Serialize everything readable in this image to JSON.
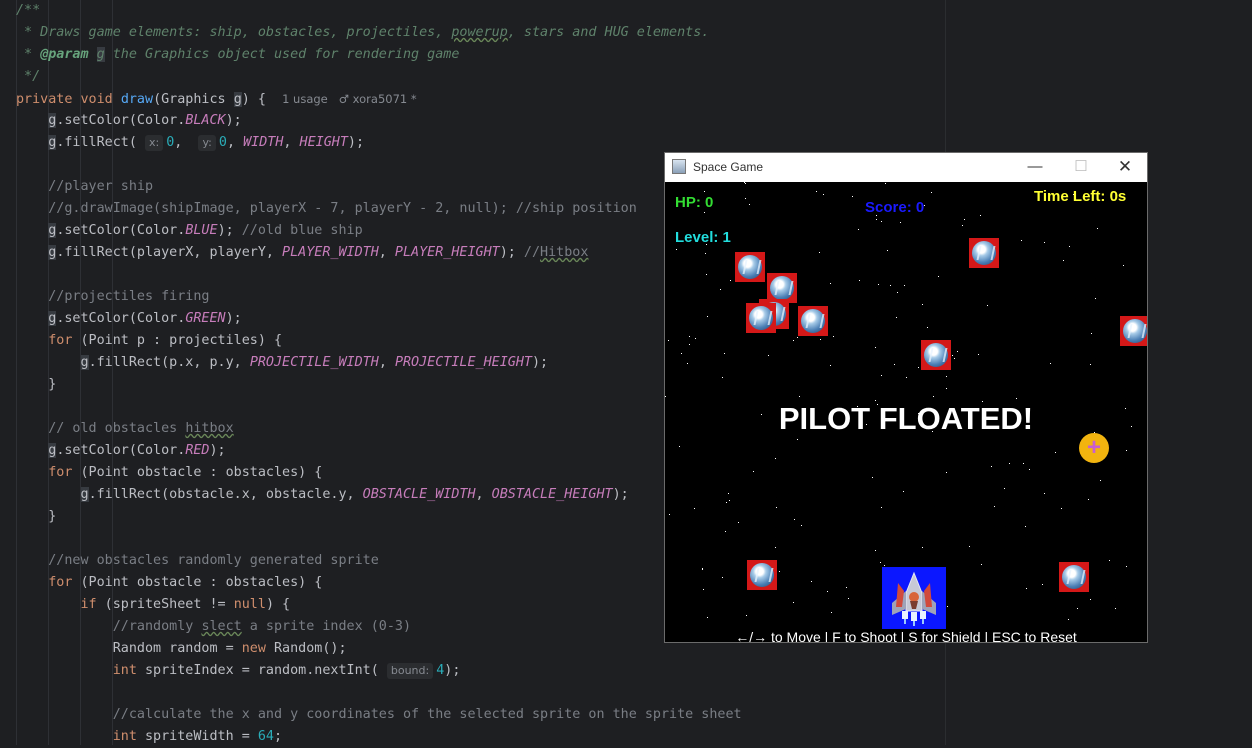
{
  "editor": {
    "lines": [
      [
        {
          "t": "/**",
          "c": "doc"
        }
      ],
      [
        {
          "t": " * Draws game elements: ship, obstacles, projectiles, ",
          "c": "doc"
        },
        {
          "t": "powerup",
          "c": "doc ulwave"
        },
        {
          "t": ", stars and HUG elements.",
          "c": "doc"
        }
      ],
      [
        {
          "t": " * ",
          "c": "doc"
        },
        {
          "t": "@param",
          "c": "doctag"
        },
        {
          "t": " ",
          "c": "doc"
        },
        {
          "t": "g",
          "c": "doc hlvar"
        },
        {
          "t": " the Graphics object used for rendering game",
          "c": "doc"
        }
      ],
      [
        {
          "t": " */",
          "c": "doc"
        }
      ],
      [
        {
          "t": "private void ",
          "c": "kw"
        },
        {
          "t": "draw",
          "c": "fn"
        },
        {
          "t": "(Graphics "
        },
        {
          "t": "g",
          "c": "hlvar"
        },
        {
          "t": ") {  "
        },
        {
          "t": "1 usage   ",
          "c": "meta"
        },
        {
          "t": "♂ xora5071 *",
          "c": "meta"
        }
      ],
      [
        {
          "t": "    "
        },
        {
          "t": "g",
          "c": "hlvar"
        },
        {
          "t": ".setColor(Color."
        },
        {
          "t": "BLACK",
          "c": "cst"
        },
        {
          "t": ");"
        }
      ],
      [
        {
          "t": "    "
        },
        {
          "t": "g",
          "c": "hlvar"
        },
        {
          "t": ".fillRect( "
        },
        {
          "t": "x:",
          "c": "hint"
        },
        {
          "t": "0",
          "c": "num"
        },
        {
          "t": ",  "
        },
        {
          "t": "y:",
          "c": "hint"
        },
        {
          "t": "0",
          "c": "num"
        },
        {
          "t": ", "
        },
        {
          "t": "WIDTH",
          "c": "cst"
        },
        {
          "t": ", "
        },
        {
          "t": "HEIGHT",
          "c": "cst"
        },
        {
          "t": ");"
        }
      ],
      [],
      [
        {
          "t": "    //player ship",
          "c": "cm"
        }
      ],
      [
        {
          "t": "    //g.drawImage(shipImage, playerX - 7, playerY - 2, null); //ship position",
          "c": "cm"
        }
      ],
      [
        {
          "t": "    "
        },
        {
          "t": "g",
          "c": "hlvar"
        },
        {
          "t": ".setColor(Color."
        },
        {
          "t": "BLUE",
          "c": "cst"
        },
        {
          "t": "); "
        },
        {
          "t": "//old blue ship",
          "c": "cm"
        }
      ],
      [
        {
          "t": "    "
        },
        {
          "t": "g",
          "c": "hlvar"
        },
        {
          "t": ".fillRect(playerX, playerY, "
        },
        {
          "t": "PLAYER_WIDTH",
          "c": "cst"
        },
        {
          "t": ", "
        },
        {
          "t": "PLAYER_HEIGHT",
          "c": "cst"
        },
        {
          "t": "); "
        },
        {
          "t": "//",
          "c": "cm"
        },
        {
          "t": "Hitbox",
          "c": "cm ulwave"
        }
      ],
      [],
      [
        {
          "t": "    //projectiles firing",
          "c": "cm"
        }
      ],
      [
        {
          "t": "    "
        },
        {
          "t": "g",
          "c": "hlvar"
        },
        {
          "t": ".setColor(Color."
        },
        {
          "t": "GREEN",
          "c": "cst"
        },
        {
          "t": ");"
        }
      ],
      [
        {
          "t": "    "
        },
        {
          "t": "for",
          "c": "kw"
        },
        {
          "t": " (Point p : projectiles) {"
        }
      ],
      [
        {
          "t": "        "
        },
        {
          "t": "g",
          "c": "hlvar"
        },
        {
          "t": ".fillRect(p.x, p.y, "
        },
        {
          "t": "PROJECTILE_WIDTH",
          "c": "cst"
        },
        {
          "t": ", "
        },
        {
          "t": "PROJECTILE_HEIGHT",
          "c": "cst"
        },
        {
          "t": ");"
        }
      ],
      [
        {
          "t": "    }"
        }
      ],
      [],
      [
        {
          "t": "    // old obstacles ",
          "c": "cm"
        },
        {
          "t": "hitbox",
          "c": "cm ulwave"
        }
      ],
      [
        {
          "t": "    "
        },
        {
          "t": "g",
          "c": "hlvar"
        },
        {
          "t": ".setColor(Color."
        },
        {
          "t": "RED",
          "c": "cst"
        },
        {
          "t": ");"
        }
      ],
      [
        {
          "t": "    "
        },
        {
          "t": "for",
          "c": "kw"
        },
        {
          "t": " (Point obstacle : obstacles) {"
        }
      ],
      [
        {
          "t": "        "
        },
        {
          "t": "g",
          "c": "hlvar"
        },
        {
          "t": ".fillRect(obstacle.x, obstacle.y, "
        },
        {
          "t": "OBSTACLE_WIDTH",
          "c": "cst"
        },
        {
          "t": ", "
        },
        {
          "t": "OBSTACLE_HEIGHT",
          "c": "cst"
        },
        {
          "t": ");"
        }
      ],
      [
        {
          "t": "    }"
        }
      ],
      [],
      [
        {
          "t": "    //new obstacles randomly generated sprite",
          "c": "cm"
        }
      ],
      [
        {
          "t": "    "
        },
        {
          "t": "for",
          "c": "kw"
        },
        {
          "t": " (Point obstacle : obstacles) {"
        }
      ],
      [
        {
          "t": "        "
        },
        {
          "t": "if",
          "c": "kw"
        },
        {
          "t": " (spriteSheet != "
        },
        {
          "t": "null",
          "c": "kw"
        },
        {
          "t": ") {"
        }
      ],
      [
        {
          "t": "            //randomly ",
          "c": "cm"
        },
        {
          "t": "slect",
          "c": "cm ulwave"
        },
        {
          "t": " a sprite index (0-3)",
          "c": "cm"
        }
      ],
      [
        {
          "t": "            Random random = "
        },
        {
          "t": "new",
          "c": "kw"
        },
        {
          "t": " Random();"
        }
      ],
      [
        {
          "t": "            "
        },
        {
          "t": "int",
          "c": "kw"
        },
        {
          "t": " spriteIndex = random.nextInt( "
        },
        {
          "t": "bound:",
          "c": "hint"
        },
        {
          "t": "4",
          "c": "num"
        },
        {
          "t": ");"
        }
      ],
      [],
      [
        {
          "t": "            //calculate the x and y coordinates of the selected sprite on the sprite sheet",
          "c": "cm"
        }
      ],
      [
        {
          "t": "            "
        },
        {
          "t": "int",
          "c": "kw"
        },
        {
          "t": " spriteWidth = "
        },
        {
          "t": "64",
          "c": "num"
        },
        {
          "t": ";"
        }
      ]
    ],
    "highlighted_line": 20
  },
  "game_window": {
    "title": "Space Game",
    "minimize_glyph": "—",
    "maximize_glyph": "☐",
    "close_glyph": "✕",
    "hud": {
      "hp": "HP: 0",
      "score": "Score: 0",
      "time_left": "Time Left: 0s",
      "level": "Level: 1"
    },
    "colors": {
      "hp": "#33dd33",
      "score": "#1a1aff",
      "time_left": "#ffff33",
      "level": "#22dddd"
    },
    "headline": "PILOT FLOATED!",
    "powerup_glyph": "+",
    "footer": "←/→ to Move | F to Shoot | S for Shield | ESC to Reset"
  }
}
